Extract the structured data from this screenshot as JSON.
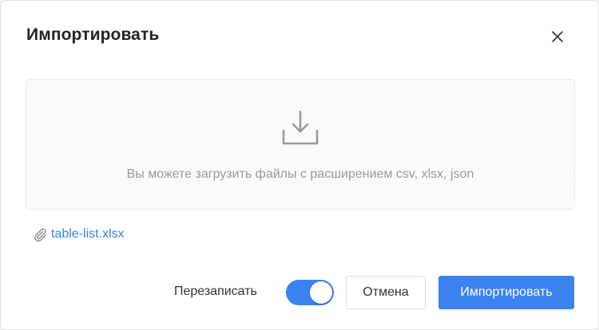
{
  "dialog": {
    "title": "Импортировать",
    "close_icon": "close-icon"
  },
  "dropzone": {
    "icon": "download-tray-icon",
    "hint": "Вы можете загрузить файлы с расширением csv, xlsx, json"
  },
  "attachments": [
    {
      "icon": "paperclip-icon",
      "name": "table-list.xlsx"
    }
  ],
  "footer": {
    "overwrite_label": "Перезаписать",
    "overwrite_enabled": true,
    "cancel_label": "Отмена",
    "import_label": "Импортировать"
  },
  "colors": {
    "accent": "#3b82f0",
    "link": "#3b82e6",
    "hint": "#9a9a9a"
  }
}
